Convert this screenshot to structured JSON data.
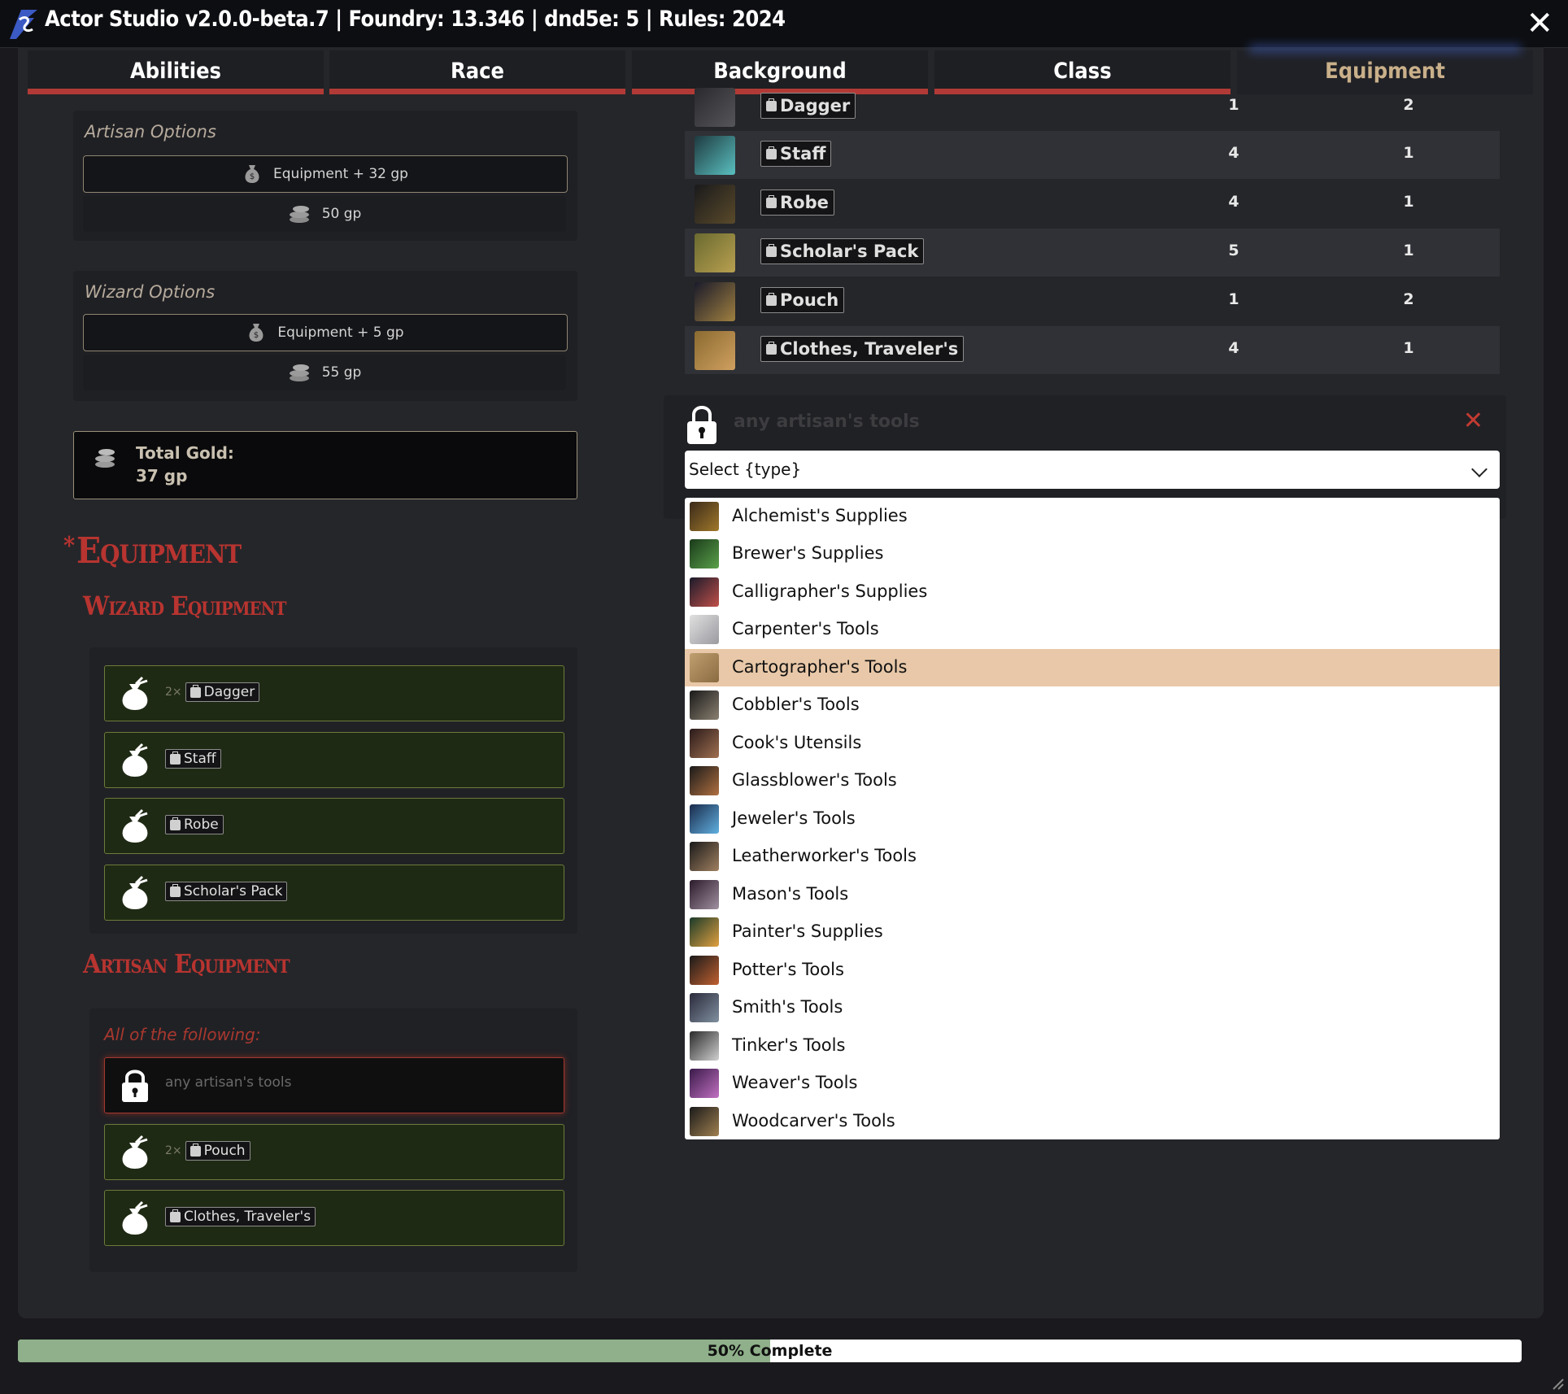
{
  "window": {
    "title": "Actor Studio v2.0.0-beta.7 | Foundry: 13.346 | dnd5e: 5 | Rules: 2024"
  },
  "tabs": [
    {
      "label": "Abilities"
    },
    {
      "label": "Race"
    },
    {
      "label": "Background"
    },
    {
      "label": "Class"
    },
    {
      "label": "Equipment"
    }
  ],
  "artisan_options": {
    "title": "Artisan Options",
    "equipment_option": "Equipment + 32 gp",
    "gold_option": "50 gp"
  },
  "wizard_options": {
    "title": "Wizard Options",
    "equipment_option": "Equipment + 5 gp",
    "gold_option": "55 gp"
  },
  "total_gold": {
    "label": "Total Gold:",
    "value": "37 gp"
  },
  "equipment_heading": {
    "asterisk": "*",
    "title": "Equipment"
  },
  "wizard_equipment": {
    "title": "Wizard Equipment",
    "items": [
      {
        "multiplier": "2×",
        "name": "Dagger"
      },
      {
        "multiplier": "",
        "name": "Staff"
      },
      {
        "multiplier": "",
        "name": "Robe"
      },
      {
        "multiplier": "",
        "name": "Scholar's Pack"
      }
    ]
  },
  "artisan_equipment": {
    "title": "Artisan Equipment",
    "subtitle": "All of the following:",
    "locked_item": "any artisan's tools",
    "items": [
      {
        "multiplier": "2×",
        "name": "Pouch"
      },
      {
        "multiplier": "",
        "name": "Clothes, Traveler's"
      }
    ]
  },
  "inventory": [
    {
      "name": "Dagger",
      "weight": "1",
      "qty": "2"
    },
    {
      "name": "Staff",
      "weight": "4",
      "qty": "1"
    },
    {
      "name": "Robe",
      "weight": "4",
      "qty": "1"
    },
    {
      "name": "Scholar's Pack",
      "weight": "5",
      "qty": "1"
    },
    {
      "name": "Pouch",
      "weight": "1",
      "qty": "2"
    },
    {
      "name": "Clothes, Traveler's",
      "weight": "4",
      "qty": "1"
    }
  ],
  "lock_panel": {
    "placeholder": "any artisan's tools",
    "close": "✕"
  },
  "select": {
    "value": "Select {type}"
  },
  "dropdown_options": [
    "Alchemist's Supplies",
    "Brewer's Supplies",
    "Calligrapher's Supplies",
    "Carpenter's Tools",
    "Cartographer's Tools",
    "Cobbler's Tools",
    "Cook's Utensils",
    "Glassblower's Tools",
    "Jeweler's Tools",
    "Leatherworker's Tools",
    "Mason's Tools",
    "Painter's Supplies",
    "Potter's Tools",
    "Smith's Tools",
    "Tinker's Tools",
    "Weaver's Tools",
    "Woodcarver's Tools"
  ],
  "dropdown_highlighted": "Cartographer's Tools",
  "progress": {
    "percent": 50,
    "label": "50% Complete"
  },
  "colors": {
    "accent_red": "#b83430",
    "tab_bar": "#b23a36",
    "item_green": "#1f2a14",
    "highlight": "#e8c8a8",
    "progress_fill": "#8fb08a"
  }
}
